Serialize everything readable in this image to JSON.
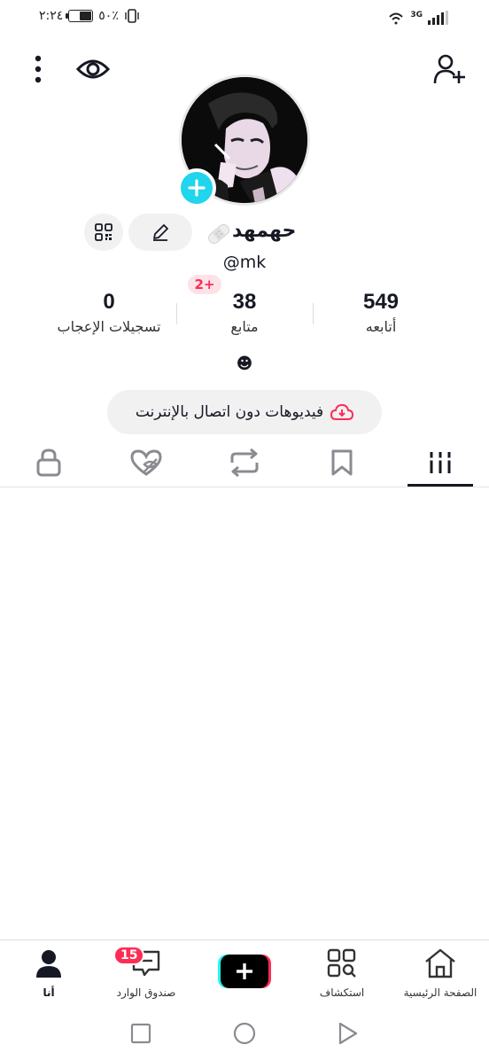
{
  "status_bar": {
    "time": "٢:٢٤",
    "battery_text": "٥٠٪",
    "battery_level": 0.5,
    "network": "3G"
  },
  "profile": {
    "display_name": "حهمهد",
    "handle": "@mk",
    "new_followers_badge": "2+",
    "bio": "☻",
    "offline_videos_label": "فيديوهات دون اتصال بالإنترنت"
  },
  "stats": [
    {
      "value": "549",
      "label": "أتابعه"
    },
    {
      "value": "38",
      "label": "متابع"
    },
    {
      "value": "0",
      "label": "تسجيلات الإعجاب"
    }
  ],
  "tabs": [
    {
      "name": "videos",
      "icon": "grid-lines-icon",
      "active": true
    },
    {
      "name": "favorites",
      "icon": "bookmark-icon",
      "active": false
    },
    {
      "name": "reposts",
      "icon": "repost-icon",
      "active": false
    },
    {
      "name": "liked",
      "icon": "heart-hidden-icon",
      "active": false
    },
    {
      "name": "private",
      "icon": "lock-icon",
      "active": false
    }
  ],
  "bottom_nav": {
    "home": "الصفحة الرئيسية",
    "discover": "استكشاف",
    "inbox": "صندوق الوارد",
    "inbox_badge": "15",
    "me": "أنا"
  },
  "colors": {
    "accent_cyan": "#20d5ec",
    "accent_pink": "#fe2c55",
    "text": "#161823"
  }
}
